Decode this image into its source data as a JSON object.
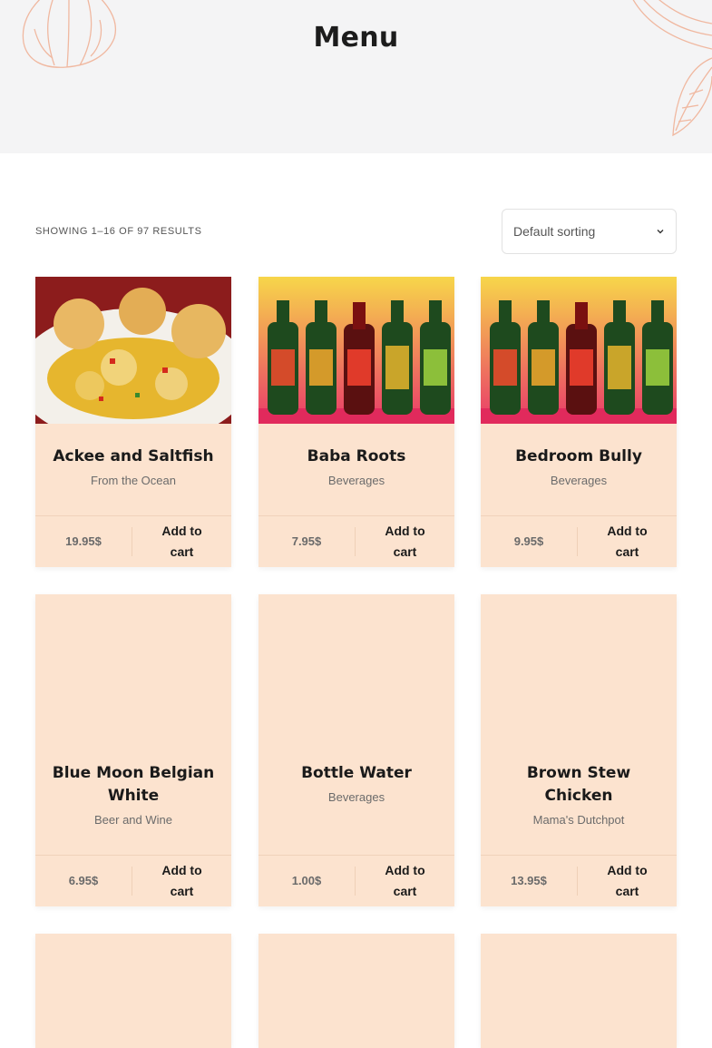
{
  "page": {
    "title": "Menu"
  },
  "toolbar": {
    "result_count": "SHOWING 1–16 OF 97 RESULTS",
    "sorting": "Default sorting"
  },
  "products": [
    {
      "name": "Ackee and Saltfish",
      "category": "From the Ocean",
      "price": "19.95$",
      "cart_label": "Add to cart",
      "image": "ackee-saltfish-photo"
    },
    {
      "name": "Baba Roots",
      "category": "Beverages",
      "price": "7.95$",
      "cart_label": "Add to cart",
      "image": "bottles-photo"
    },
    {
      "name": "Bedroom Bully",
      "category": "Beverages",
      "price": "9.95$",
      "cart_label": "Add to cart",
      "image": "bottles-photo"
    },
    {
      "name": "Blue Moon Belgian White",
      "category": "Beer and Wine",
      "price": "6.95$",
      "cart_label": "Add to cart",
      "image": ""
    },
    {
      "name": "Bottle Water",
      "category": "Beverages",
      "price": "1.00$",
      "cart_label": "Add to cart",
      "image": ""
    },
    {
      "name": "Brown Stew Chicken",
      "category": "Mama's Dutchpot",
      "price": "13.95$",
      "cart_label": "Add to cart",
      "image": ""
    },
    {
      "name": "",
      "category": "",
      "price": "",
      "cart_label": "",
      "image": ""
    },
    {
      "name": "",
      "category": "",
      "price": "",
      "cart_label": "",
      "image": ""
    },
    {
      "name": "",
      "category": "",
      "price": "",
      "cart_label": "",
      "image": ""
    }
  ],
  "colors": {
    "card_bg": "#fce3cf",
    "hero_bg": "#f4f4f5",
    "deco_line": "#f0b8a0"
  }
}
